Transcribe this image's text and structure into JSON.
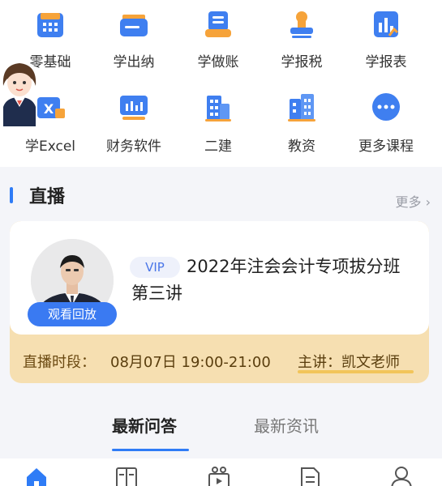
{
  "grid": [
    {
      "label": "零基础",
      "icon": "calculator-icon"
    },
    {
      "label": "学出纳",
      "icon": "wallet-icon"
    },
    {
      "label": "学做账",
      "icon": "ledger-icon"
    },
    {
      "label": "学报税",
      "icon": "stamp-icon"
    },
    {
      "label": "学报表",
      "icon": "report-chart-icon"
    },
    {
      "label": "学Excel",
      "icon": "excel-icon"
    },
    {
      "label": "财务软件",
      "icon": "finance-software-icon"
    },
    {
      "label": "二建",
      "icon": "building-icon"
    },
    {
      "label": "教资",
      "icon": "school-building-icon"
    },
    {
      "label": "更多课程",
      "icon": "more-dots-icon"
    }
  ],
  "live": {
    "section_title": "直播",
    "more_label": "更多 ›",
    "vip_tag": "VIP",
    "course_title": "2022年注会会计专项拔分班第三讲",
    "replay_button": "观看回放",
    "time_label": "直播时段：",
    "time_value": "08月07日 19:00-21:00",
    "teacher_text": "主讲：凯文老师"
  },
  "tabs": {
    "active": "最新问答",
    "inactive": "最新资讯"
  },
  "bottom_nav": [
    "home-icon",
    "book-icon",
    "video-icon",
    "document-icon",
    "profile-icon"
  ],
  "colors": {
    "accent": "#2f7cf6",
    "card_footer": "#f6dfb1",
    "icon_blue": "#3f7ff0",
    "icon_orange": "#f6a33a"
  }
}
